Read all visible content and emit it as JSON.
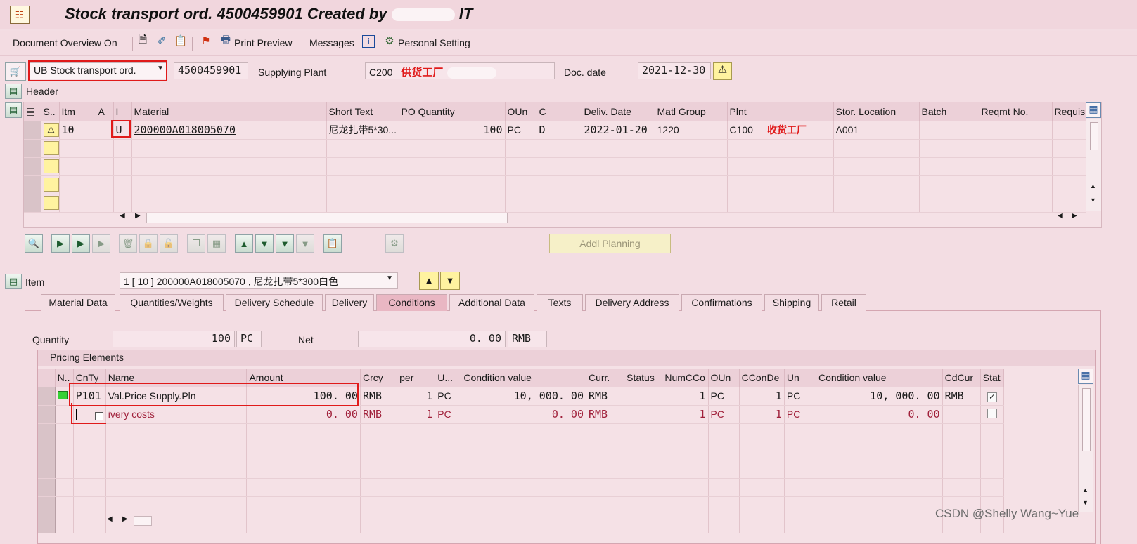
{
  "title": {
    "prefix": "Stock transport ord. 4500459901 Created by",
    "suffix": "IT"
  },
  "toolbar": {
    "doc_overview": "Document Overview On",
    "print_preview": "Print Preview",
    "messages": "Messages",
    "personal_setting": "Personal Setting"
  },
  "header": {
    "doc_type": "UB Stock transport ord.",
    "po_number": "4500459901",
    "supplying_plant_label": "Supplying Plant",
    "supplying_plant_value": "C200",
    "supplying_plant_annotation": "供货工厂",
    "doc_date_label": "Doc. date",
    "doc_date_value": "2021-12-30",
    "header_label": "Header"
  },
  "items_table": {
    "columns": [
      "S..",
      "Itm",
      "A",
      "I",
      "Material",
      "Short Text",
      "PO Quantity",
      "OUn",
      "C",
      "Deliv. Date",
      "Matl Group",
      "Plnt",
      "Stor. Location",
      "Batch",
      "Reqmt No.",
      "Requisit"
    ],
    "row": {
      "itm": "10",
      "item_category": "U",
      "material": "200000A018005070",
      "short_text": "尼龙扎带5*30...",
      "po_quantity": "100",
      "oun": "PC",
      "c": "D",
      "deliv_date": "2022-01-20",
      "matl_group": "1220",
      "plnt": "C100",
      "plnt_annotation": "收货工厂",
      "stor_location": "A001"
    }
  },
  "addl_planning": "Addl Planning",
  "item_selector": {
    "label": "Item",
    "value": "1 [ 10 ] 200000A018005070 , 尼龙扎带5*300白色"
  },
  "tabs": [
    "Material Data",
    "Quantities/Weights",
    "Delivery Schedule",
    "Delivery",
    "Conditions",
    "Additional Data",
    "Texts",
    "Delivery Address",
    "Confirmations",
    "Shipping",
    "Retail"
  ],
  "conditions": {
    "quantity_label": "Quantity",
    "quantity_value": "100",
    "quantity_unit": "PC",
    "net_label": "Net",
    "net_value": "0. 00",
    "net_currency": "RMB",
    "pricing_elements_title": "Pricing Elements",
    "columns": [
      "N..",
      "CnTy",
      "Name",
      "Amount",
      "Crcy",
      "per",
      "U...",
      "Condition value",
      "Curr.",
      "Status",
      "NumCCo",
      "OUn",
      "CConDe",
      "Un",
      "Condition value",
      "CdCur",
      "Stat"
    ],
    "rows": [
      {
        "cnty": "P101",
        "name": "Val.Price Supply.Pln",
        "amount": "100. 00",
        "crcy": "RMB",
        "per": "1",
        "u": "PC",
        "cond_value": "10, 000. 00",
        "curr": "RMB",
        "numcco": "1",
        "oun": "PC",
        "ccon": "1",
        "un": "PC",
        "cond_value2": "10, 000. 00",
        "cdcur": "RMB",
        "checked": true
      },
      {
        "cnty": "",
        "name": "ivery costs",
        "amount": "0. 00",
        "crcy": "RMB",
        "per": "1",
        "u": "PC",
        "cond_value": "0. 00",
        "curr": "RMB",
        "numcco": "1",
        "oun": "PC",
        "ccon": "1",
        "un": "PC",
        "cond_value2": "0. 00",
        "cdcur": "",
        "checked": false
      }
    ]
  },
  "watermark": "CSDN @Shelly Wang~Yue",
  "colors": {
    "background": "#f3dde3",
    "annotation_red": "#e01a1a",
    "active_tab": "#e9b7c3"
  }
}
